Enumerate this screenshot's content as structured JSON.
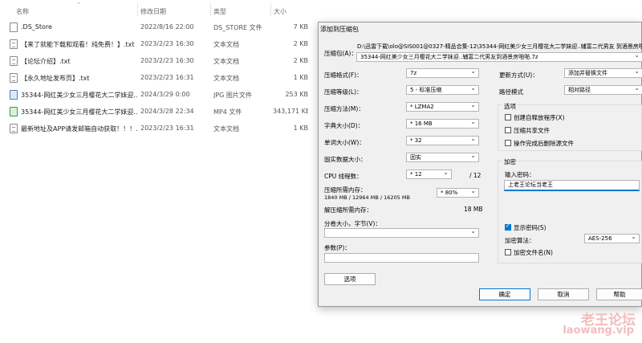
{
  "explorer": {
    "headers": {
      "name": "名称",
      "date": "修改日期",
      "type": "类型",
      "size": "大小"
    },
    "files": [
      {
        "name": ".DS_Store",
        "date": "2022/8/16 22:00",
        "type": "DS_STORE 文件",
        "size": "7 KB",
        "icon": "file-icon"
      },
      {
        "name": "【来了就能下载和观看！纯免费！】.txt",
        "date": "2023/2/23 16:30",
        "type": "文本文档",
        "size": "2 KB",
        "icon": "text-file-icon"
      },
      {
        "name": "【论坛介绍】.txt",
        "date": "2023/2/23 16:30",
        "type": "文本文档",
        "size": "2 KB",
        "icon": "text-file-icon"
      },
      {
        "name": "【永久地址发布页】.txt",
        "date": "2023/2/23 16:31",
        "type": "文本文档",
        "size": "1 KB",
        "icon": "text-file-icon"
      },
      {
        "name": "35344-网红美少女三月樱花大二学妹迎...",
        "date": "2024/3/29 0:00",
        "type": "JPG 图片文件",
        "size": "253 KB",
        "icon": "image-file-icon"
      },
      {
        "name": "35344-网红美少女三月樱花大二学妹迎...",
        "date": "2024/3/28 22:34",
        "type": "MP4 文件",
        "size": "343,171 KB",
        "icon": "video-file-icon"
      },
      {
        "name": "最新地址及APP请发邮箱自动获取！！！...",
        "date": "2023/2/23 16:31",
        "type": "文本文档",
        "size": "1 KB",
        "icon": "text-file-icon"
      }
    ]
  },
  "dialog": {
    "title": "添加到压缩包",
    "archive_label": "压缩包(A)：",
    "archive_path": "D:\\迅雷下载\\olo@SIS001@0327-精品合集-12\\35344-网红美少女三月樱花大二学妹迎..辅富二代男友 到酒景房啪啪",
    "archive_name": "35344-网红美少女三月樱花大二学妹迎..辅富二代男友到酒景房啪啪.7z",
    "format_label": "压缩格式(F)：",
    "format_value": "7z",
    "level_label": "压缩等级(L)：",
    "level_value": "5 - 标准压缩",
    "method_label": "压缩方法(M)：",
    "method_value": "* LZMA2",
    "dict_label": "字典大小(D)：",
    "dict_value": "* 16 MB",
    "word_label": "单词大小(W)：",
    "word_value": "* 32",
    "solid_label": "固实数据大小：",
    "solid_value": "固实",
    "cpu_label": "CPU 线程数：",
    "cpu_value": "* 12",
    "cpu_total": "/ 12",
    "mem_label": "压缩所需内存：",
    "mem_detail": "1840 MB / 12964 MB / 16205 MB",
    "mem_percent": "* 80%",
    "decomp_label": "解压缩所需内存：",
    "decomp_value": "18 MB",
    "split_label": "分卷大小，字节(V)：",
    "split_value": "",
    "params_label": "参数(P)：",
    "params_value": "",
    "options_btn": "选项",
    "update_label": "更新方式(U)：",
    "update_value": "添加并替换文件",
    "path_label": "路径模式",
    "path_value": "相对路径",
    "options_group": "选项",
    "opt_sfx": "创建自释放程序(X)",
    "opt_shared": "压缩共享文件",
    "opt_delete": "操作完成后删除源文件",
    "encrypt_group": "加密",
    "pwd_label": "输入密码：",
    "pwd_value": "上老王论坛当老王",
    "show_pwd": "显示密码(S)",
    "enc_method_label": "加密算法：",
    "enc_method_value": "AES-256",
    "enc_names": "加密文件名(N)",
    "ok": "确定",
    "cancel": "取消",
    "help": "帮助"
  },
  "watermark": {
    "line1": "老王论坛",
    "line2": "laowang.vip"
  }
}
